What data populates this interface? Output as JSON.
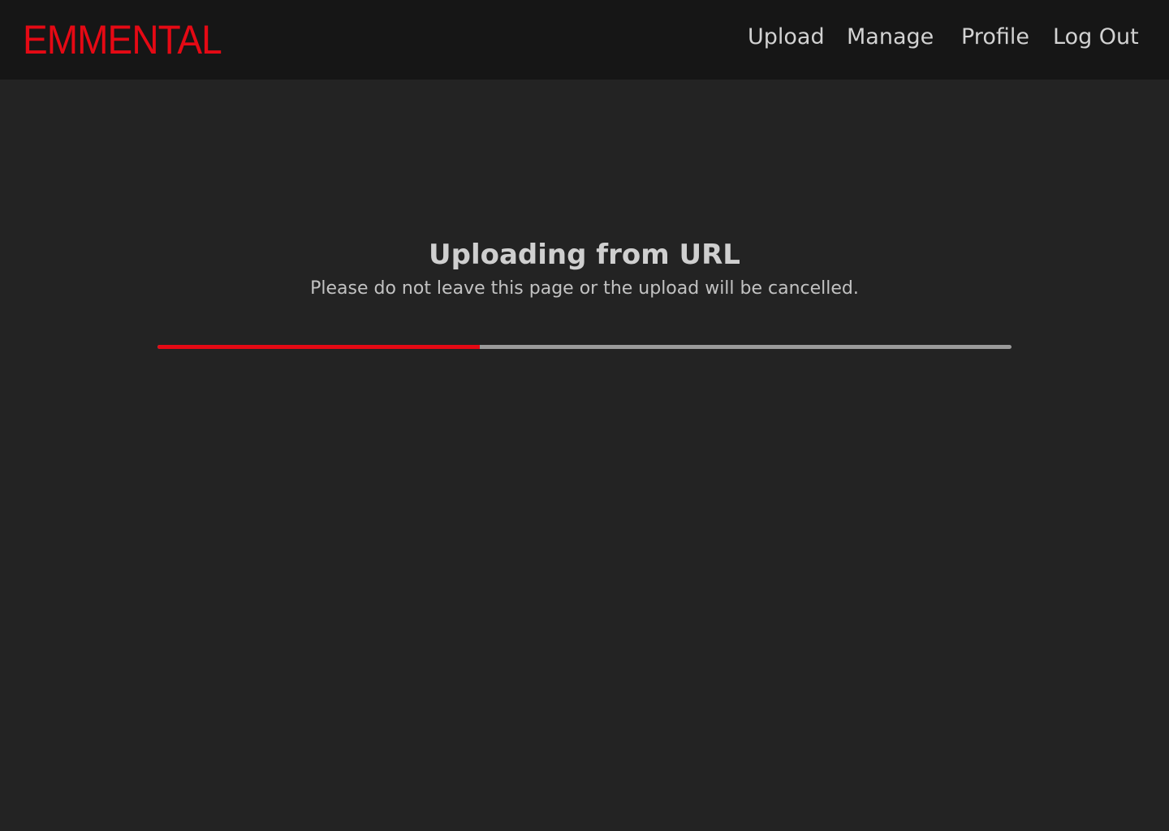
{
  "header": {
    "logo_text": "EMMENTAL",
    "nav": {
      "upload": "Upload",
      "manage": "Manage",
      "profile": "Profile",
      "logout": "Log Out"
    }
  },
  "main": {
    "title": "Uploading from URL",
    "subtitle": "Please do not leave this page or the upload will be cancelled.",
    "progress": {
      "fraction": 0.377
    }
  },
  "colors": {
    "brand": "#e50914",
    "header_bg": "#161616",
    "page_bg": "#232323",
    "progress_track": "#9a9a9a"
  }
}
